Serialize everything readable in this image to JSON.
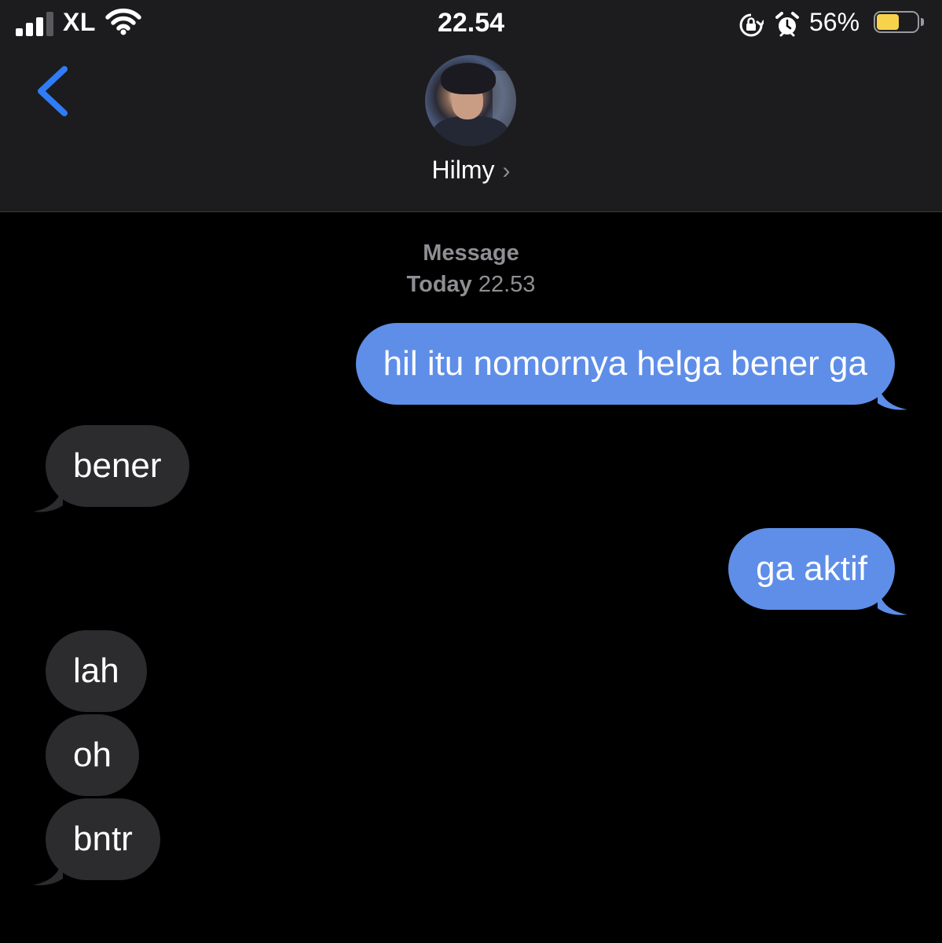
{
  "status_bar": {
    "carrier": "XL",
    "time": "22.54",
    "battery_percent_text": "56%",
    "battery_level": 0.56,
    "signal_bars": 3
  },
  "header": {
    "contact_name": "Hilmy",
    "back_icon": "chevron-left-icon",
    "chevron_icon": "chevron-right-icon"
  },
  "thread": {
    "service_label": "Message",
    "day_label": "Today",
    "time_label": "22.53"
  },
  "messages": [
    {
      "from": "me",
      "text": "hil itu nomornya helga bener ga"
    },
    {
      "from": "them",
      "text": "bener"
    },
    {
      "from": "me",
      "text": "ga aktif"
    },
    {
      "from": "them",
      "text": "lah"
    },
    {
      "from": "them",
      "text": "oh"
    },
    {
      "from": "them",
      "text": "bntr"
    }
  ],
  "colors": {
    "sent_bubble": "#5e8ee8",
    "received_bubble": "#2c2c2e",
    "accent": "#2f7cf6",
    "battery": "#f6d34a"
  }
}
